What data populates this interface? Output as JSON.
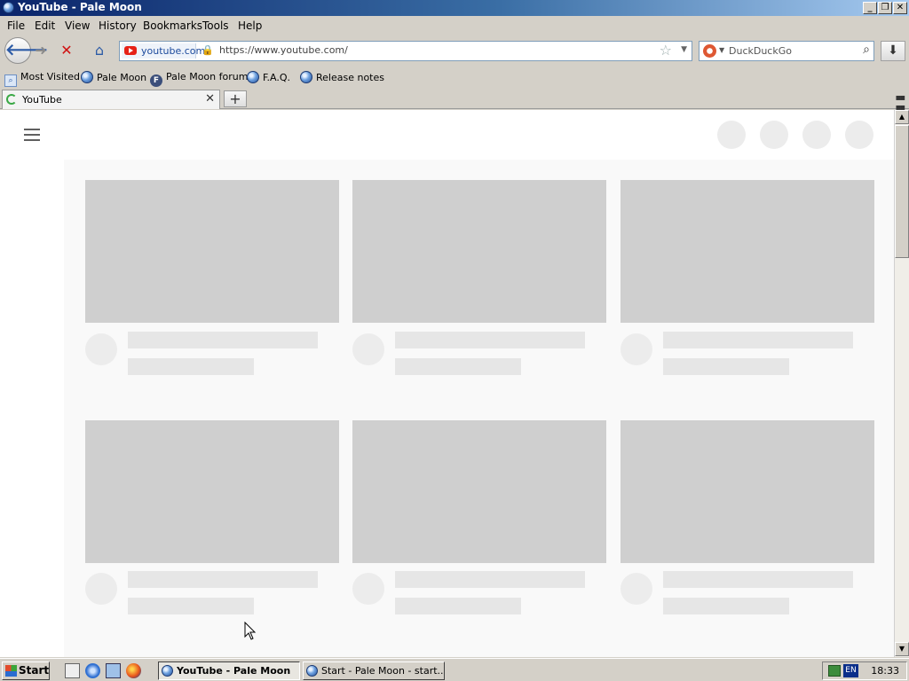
{
  "window": {
    "title": "YouTube - Pale Moon"
  },
  "menu": [
    "File",
    "Edit",
    "View",
    "History",
    "Bookmarks",
    "Tools",
    "Help"
  ],
  "navbar": {
    "site_badge": "youtube.com",
    "url": "https://www.youtube.com/",
    "search_placeholder": "DuckDuckGo"
  },
  "bookmarks": [
    "Most Visited",
    "Pale Moon",
    "Pale Moon forum",
    "F.A.Q.",
    "Release notes"
  ],
  "tabs": [
    {
      "label": "YouTube"
    }
  ],
  "taskbar": {
    "start_label": "Start",
    "tasks": [
      "YouTube - Pale Moon",
      "Start - Pale Moon - start...."
    ],
    "lang": "EN",
    "clock": "18:33"
  },
  "colors": {
    "titlebar_start": "#0a246a",
    "placeholder_thumb": "#cfcfcf",
    "placeholder_line": "#e6e6e6",
    "youtube_red": "#e62117"
  },
  "icons": [
    "back-arrow-icon",
    "forward-arrow-icon",
    "stop-icon",
    "home-icon",
    "lock-icon",
    "star-icon",
    "download-icon",
    "search-icon",
    "spinner-icon"
  ]
}
